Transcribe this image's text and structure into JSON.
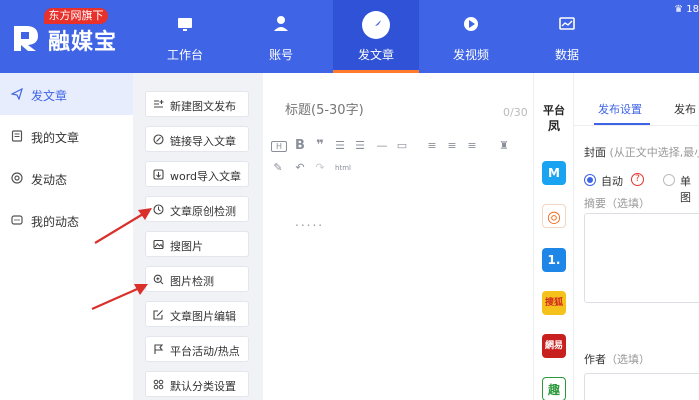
{
  "header": {
    "badge": "东方网旗下",
    "logo_text": "融媒宝",
    "user_text": "18"
  },
  "nav": [
    {
      "label": "工作台",
      "icon": "monitor-icon"
    },
    {
      "label": "账号",
      "icon": "user-icon"
    },
    {
      "label": "发文章",
      "icon": "compass-icon",
      "active": true
    },
    {
      "label": "发视频",
      "icon": "play-icon"
    },
    {
      "label": "数据",
      "icon": "chart-icon"
    }
  ],
  "left_menu": [
    {
      "label": "发文章",
      "active": true
    },
    {
      "label": "我的文章"
    },
    {
      "label": "发动态"
    },
    {
      "label": "我的动态"
    }
  ],
  "tools": [
    "新建图文发布",
    "链接导入文章",
    "word导入文章",
    "文章原创检测",
    "搜图片",
    "图片检测",
    "文章图片编辑",
    "平台活动/热点",
    "默认分类设置"
  ],
  "editor": {
    "title_placeholder": "标题(5-30字)",
    "title_count": "0/30",
    "body_placeholder": "....."
  },
  "platform": {
    "title": "平台",
    "icons": [
      {
        "name": "ifeng-icon",
        "glyph": "凤"
      },
      {
        "name": "dayu-icon",
        "glyph": "M"
      },
      {
        "name": "weibo-icon",
        "glyph": "◎"
      },
      {
        "name": "yidian-icon",
        "glyph": "1."
      },
      {
        "name": "sohu-icon",
        "glyph": "搜狐"
      },
      {
        "name": "netease-icon",
        "glyph": "網易"
      },
      {
        "name": "qutoutiao-icon",
        "glyph": "趣"
      }
    ]
  },
  "settings": {
    "tab_publish": "发布设置",
    "tab_publish2": "发布",
    "cover_label": "封面",
    "cover_hint": "(从正文中选择,最小",
    "radio_auto": "自动",
    "radio_single": "单图",
    "summary_label": "摘要（选填）",
    "author_label": "作者",
    "author_hint": "（选填）"
  },
  "colors": {
    "brand": "#3f64e6",
    "accent": "#ff7a2a",
    "badge": "#e8312b",
    "arrow": "#d9302b"
  }
}
